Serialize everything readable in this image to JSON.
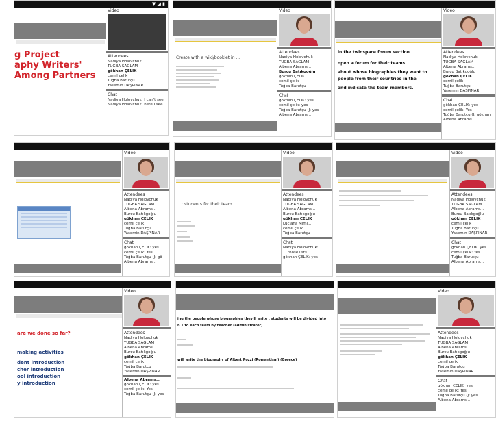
{
  "labels": {
    "video": "Video",
    "attendees": "Attendees",
    "chat": "Chat"
  },
  "tile1": {
    "status_icons": "▼ ◢ ▮",
    "title_lines": [
      "g Project",
      "aphy Writers'",
      "Among Partners"
    ],
    "attendees": [
      "Nadiya Holovchuk",
      "TUĞBA SAĞLAM",
      "gökhan ÇELİK",
      "cemil çelik",
      "Tuğba Barutçu",
      "Yasemin DAŞPINAR"
    ],
    "chat": [
      "Nadiya Holovchuk: I can't see",
      "Nadiya Holovchuk: here I see"
    ]
  },
  "tile2": {
    "heading": "Create with a wiki/booklet in ...",
    "attendees": [
      "Nadiya Holovchuk",
      "TUĞBA SAĞLAM",
      "Albena Abrams...",
      "Burcu Batıkgoğlu",
      "gökhan ÇELİK",
      "cemil çelik",
      "Tuğba Barutçu"
    ],
    "chat": [
      "gökhan ÇELİK: yes",
      "cemil çelik: yes",
      "Tuğba Barutçu (J: yes",
      "Albena Abrams..."
    ]
  },
  "tile3": {
    "lines": [
      "in the twinspace forum section",
      "open a forum for their teams",
      "about whose biographies they want to",
      "people from their countries in the",
      "and indicate the team members."
    ],
    "attendees": [
      "Nadiya Holovchuk",
      "TUĞBA SAĞLAM",
      "Albena Abrams...",
      "Burcu Batıkgoğlu",
      "gökhan ÇELİK",
      "cemil çelik",
      "Tuğba Barutçu",
      "Yasemin DAŞPINAR"
    ],
    "chat": [
      "gökhan ÇELİK: yes",
      "cemil çelik: Yes",
      "Tuğba Barutçu (J: gökhan",
      "Albena Abrams..."
    ]
  },
  "tile4": {
    "attendees": [
      "Nadiya Holovchuk",
      "TUĞBA SAĞLAM",
      "Albena Abrams...",
      "Burcu Batıkgoğlu",
      "gökhan ÇELİK",
      "cemil çelik",
      "Tuğba Barutçu",
      "Yasemin DAŞPINAR"
    ],
    "chat": [
      "gökhan ÇELİK: yes",
      "cemil çelik: Yes",
      "Tuğba Barutçu (J: gö",
      "Albena Abrams..."
    ]
  },
  "tile5": {
    "heading": "...r  students for their team ...",
    "attendees": [
      "Nadiya Holovchuk",
      "TUĞBA SAĞLAM",
      "Albena Abrams...",
      "Burcu Batıkgoğlu",
      "gökhan ÇELİK",
      "Luciana Mimi...",
      "cemil çelik",
      "Tuğba Barutçu"
    ],
    "chat": [
      "Nadiya Holovchuk:",
      "... those lists",
      "gökhan ÇELİK: yes"
    ]
  },
  "tile6": {
    "attendees": [
      "Nadiya Holovchuk",
      "TUĞBA SAĞLAM",
      "Albena Abrams...",
      "Burcu Batıkgoğlu",
      "gökhan ÇELİK",
      "cemil çelik",
      "Tuğba Barutçu",
      "Yasemin DAŞPINAR"
    ],
    "chat": [
      "gökhan ÇELİK: yes",
      "cemil çelik: Yes",
      "Tuğba Barutçu",
      "Albena Abrams..."
    ]
  },
  "tile7": {
    "red_line": "are we done so far?",
    "lines": [
      "making activities",
      "dent introduction",
      "cher introduction",
      "ool introduction",
      "y introduction"
    ],
    "attendees": [
      "Nadiya Holovchuk",
      "TUĞBA SAĞLAM",
      "Albena Abrams...",
      "Burcu Batıkgoğlu",
      "gökhan ÇELİK",
      "cemil çelik",
      "Tuğba Barutçu",
      "Yasemin DAŞPINAR"
    ],
    "chat": [
      "Albena Abrams...",
      "gökhan ÇELİK: yes",
      "cemil çelik: Yes",
      "Tuğba Barutçu (J: yes"
    ]
  },
  "tile8": {
    "lines": [
      "ing the people whose biographies they'll write , students will be divided into",
      "n 1 to each team by teacher (administrator).",
      "will write the biography of Albert Pozzi (Romantism) (Greece)"
    ]
  },
  "tile9": {
    "attendees": [
      "Nadiya Holovchuk",
      "TUĞBA SAĞLAM",
      "Albena Abrams...",
      "Burcu Batıkgoğlu",
      "gökhan ÇELİK",
      "cemil çelik",
      "Tuğba Barutçu",
      "Yasemin DAŞPINAR"
    ],
    "chat": [
      "gökhan ÇELİK: yes",
      "cemil çelik: Yes",
      "Tuğba Barutçu (J: yes",
      "Albena Abrams..."
    ]
  }
}
